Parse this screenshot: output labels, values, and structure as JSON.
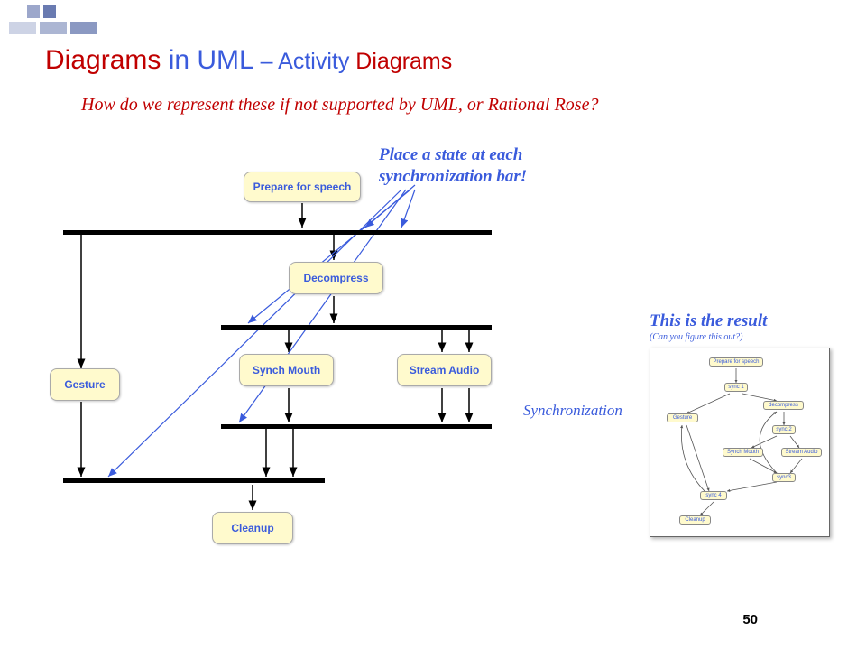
{
  "title": {
    "part1": "Diagrams",
    "part2": " in UML",
    "part3": " – Activity",
    "part4": " Diagrams"
  },
  "subtitle": "How do we represent these if not supported by UML, or Rational Rose?",
  "hint_line1": "Place a state at each",
  "hint_line2": "synchronization bar!",
  "result_label": "This is the result",
  "result_sub": "(Can you figure this out?)",
  "sync_label": "Synchronization",
  "page_number": "50",
  "activities": {
    "prepare": "Prepare for speech",
    "decompress": "Decompress",
    "gesture": "Gesture",
    "synch_mouth": "Synch Mouth",
    "stream_audio": "Stream Audio",
    "cleanup": "Cleanup"
  },
  "thumb": {
    "prepare": "Prepare for speech",
    "sync1": "sync 1",
    "decompress": "decompress",
    "gesture": "Gesture",
    "sync2": "sync 2",
    "synch_mouth": "Synch Mouth",
    "stream_audio": "Stream Audio",
    "sync3": "sync3",
    "sync4": "sync 4",
    "cleanup": "Cleanup"
  }
}
